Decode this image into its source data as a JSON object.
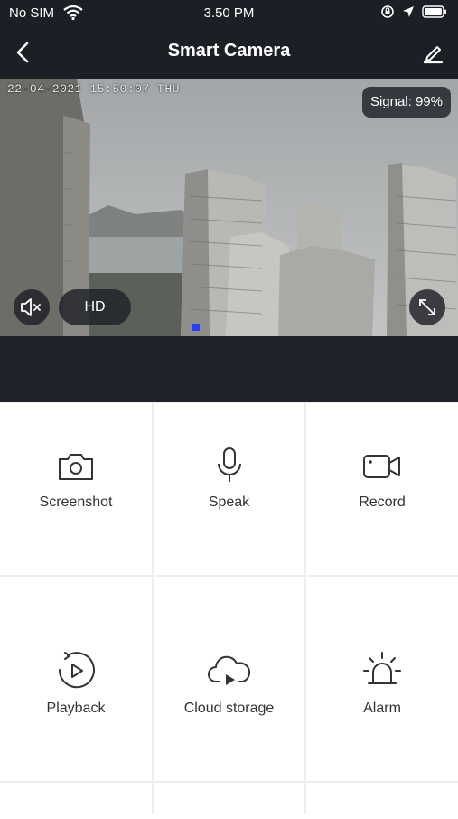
{
  "status_bar": {
    "carrier": "No SIM",
    "time": "3.50 PM",
    "icons": [
      "wifi-icon",
      "orientation-lock-icon",
      "location-icon",
      "battery-icon"
    ]
  },
  "nav": {
    "title": "Smart Camera",
    "back_icon": "chevron-left-icon",
    "edit_icon": "pencil-icon"
  },
  "video": {
    "timestamp": "22-04-2021 15:50:07 THU",
    "signal": "Signal: 99%",
    "quality": "HD",
    "mute_icon": "speaker-muted-icon",
    "fullscreen_icon": "expand-icon"
  },
  "actions": [
    {
      "label": "Screenshot",
      "icon": "camera-icon"
    },
    {
      "label": "Speak",
      "icon": "microphone-icon"
    },
    {
      "label": "Record",
      "icon": "video-camera-icon"
    },
    {
      "label": "Playback",
      "icon": "playback-icon"
    },
    {
      "label": "Cloud storage",
      "icon": "cloud-play-icon"
    },
    {
      "label": "Alarm",
      "icon": "alarm-siren-icon"
    }
  ],
  "colors": {
    "header_bg": "#1c1f26",
    "grid_divider": "#eeeeee",
    "icon_stroke": "#333333"
  }
}
